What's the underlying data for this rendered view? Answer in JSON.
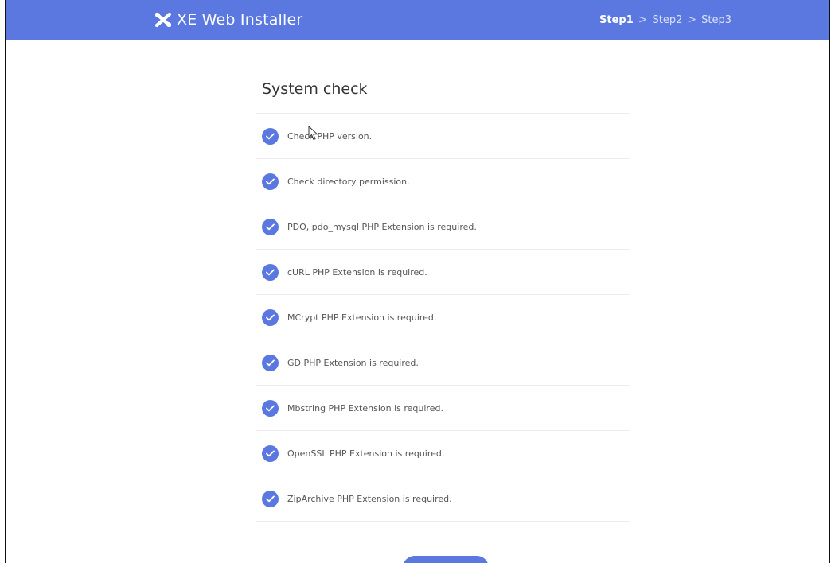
{
  "header": {
    "brand": "XE Web Installer",
    "logo_icon": "xe-logo-icon",
    "steps": [
      {
        "label": "Step1",
        "active": true
      },
      {
        "label": "Step2",
        "active": false
      },
      {
        "label": "Step3",
        "active": false
      }
    ],
    "separator": ">"
  },
  "main": {
    "title": "System check",
    "checks": [
      {
        "label": "Check PHP version.",
        "status": "passed",
        "icon": "check-circle-icon"
      },
      {
        "label": "Check directory permission.",
        "status": "passed",
        "icon": "check-circle-icon"
      },
      {
        "label": "PDO, pdo_mysql PHP Extension is required.",
        "status": "passed",
        "icon": "check-circle-icon"
      },
      {
        "label": "cURL PHP Extension is required.",
        "status": "passed",
        "icon": "check-circle-icon"
      },
      {
        "label": "MCrypt PHP Extension is required.",
        "status": "passed",
        "icon": "check-circle-icon"
      },
      {
        "label": "GD PHP Extension is required.",
        "status": "passed",
        "icon": "check-circle-icon"
      },
      {
        "label": "Mbstring PHP Extension is required.",
        "status": "passed",
        "icon": "check-circle-icon"
      },
      {
        "label": "OpenSSL PHP Extension is required.",
        "status": "passed",
        "icon": "check-circle-icon"
      },
      {
        "label": "ZipArchive PHP Extension is required.",
        "status": "passed",
        "icon": "check-circle-icon"
      }
    ]
  },
  "colors": {
    "accent": "#5a78e0",
    "divider": "#ececec",
    "text": "#555555"
  }
}
